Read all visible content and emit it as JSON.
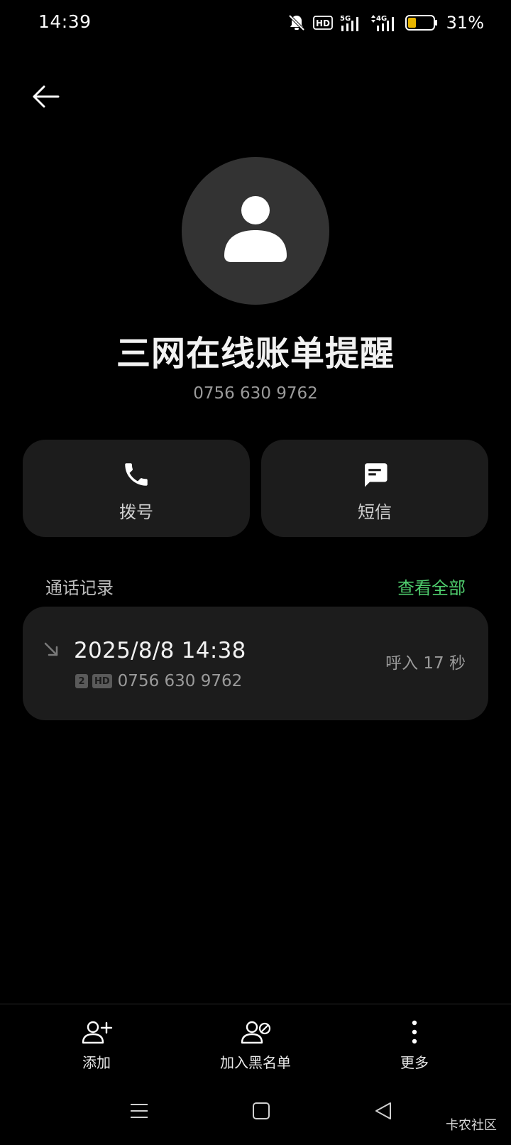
{
  "status_bar": {
    "time": "14:39",
    "battery_percent": "31%",
    "battery_level": 0.31,
    "network_5g": "5G",
    "network_4g": "4G",
    "hd_badge": "HD",
    "icons": [
      "bell-off-icon",
      "hd-icon",
      "signal-5g-icon",
      "signal-4g-icon",
      "battery-icon"
    ]
  },
  "header": {
    "back_icon": "arrow-left-icon"
  },
  "contact": {
    "name": "三网在线账单提醒",
    "number": "0756 630 9762"
  },
  "actions": {
    "dial_label": "拨号",
    "sms_label": "短信"
  },
  "call_log": {
    "title": "通话记录",
    "view_all": "查看全部",
    "records": [
      {
        "date": "2025/8/8 14:38",
        "sim": "2",
        "hd": "HD",
        "number": "0756 630 9762",
        "type": "呼入  17 秒"
      }
    ]
  },
  "toolbar": {
    "add_label": "添加",
    "blacklist_label": "加入黑名单",
    "more_label": "更多"
  },
  "watermark": "卡农社区",
  "colors": {
    "background": "#000000",
    "card": "#1c1c1c",
    "accent_green": "#4ecb6c",
    "avatar_bg": "#333333",
    "battery_fill": "#e8b500"
  }
}
